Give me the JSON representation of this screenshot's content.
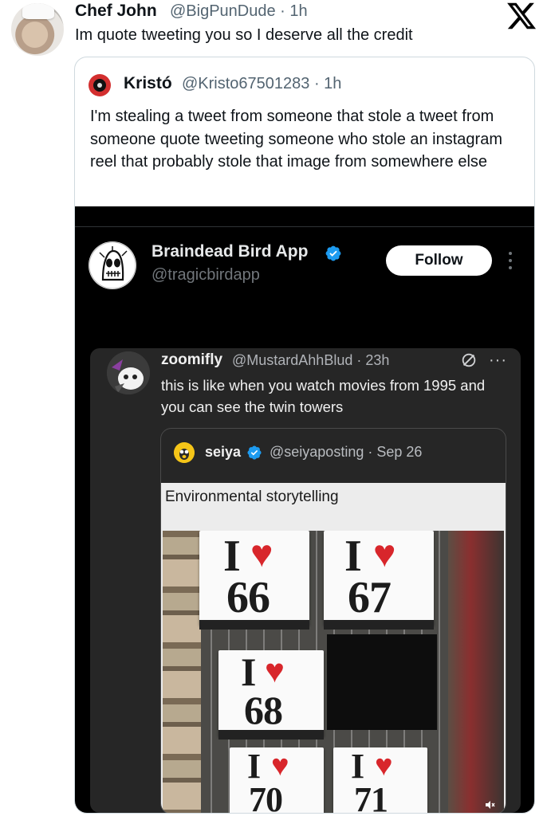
{
  "top_tweet": {
    "name": "Chef John",
    "handle": "@BigPunDude · 1h",
    "text": "Im quote tweeting you so I deserve all the credit",
    "logo_icon": "x-logo-icon"
  },
  "quoted": {
    "name": "Kristó",
    "handle": "@Kristo67501283 · 1h",
    "text": "I'm stealing a tweet from someone that stole a tweet from someone quote tweeting someone who stole an instagram reel that probably stole that image from somewhere else"
  },
  "media": {
    "account": {
      "name": "Braindead Bird App",
      "handle": "@tragicbirdapp",
      "follow_label": "Follow",
      "verified_color": "#1d9bf0"
    },
    "inner_tweet": {
      "name": "zoomifly",
      "handle": "@MustardAhhBlud · 23h",
      "more": "···",
      "text": "this is like when you watch movies from 1995 and you can see the twin towers"
    },
    "inner_quote": {
      "name": "seiya",
      "handle": "@seiyaposting · Sep 26",
      "caption": "Environmental storytelling",
      "cards": [
        {
          "i": "I",
          "num": "66"
        },
        {
          "i": "I",
          "num": "67"
        },
        {
          "i": "I",
          "num": "68"
        },
        {
          "i": "I",
          "num": "70"
        },
        {
          "i": "I",
          "num": "71"
        }
      ]
    }
  }
}
